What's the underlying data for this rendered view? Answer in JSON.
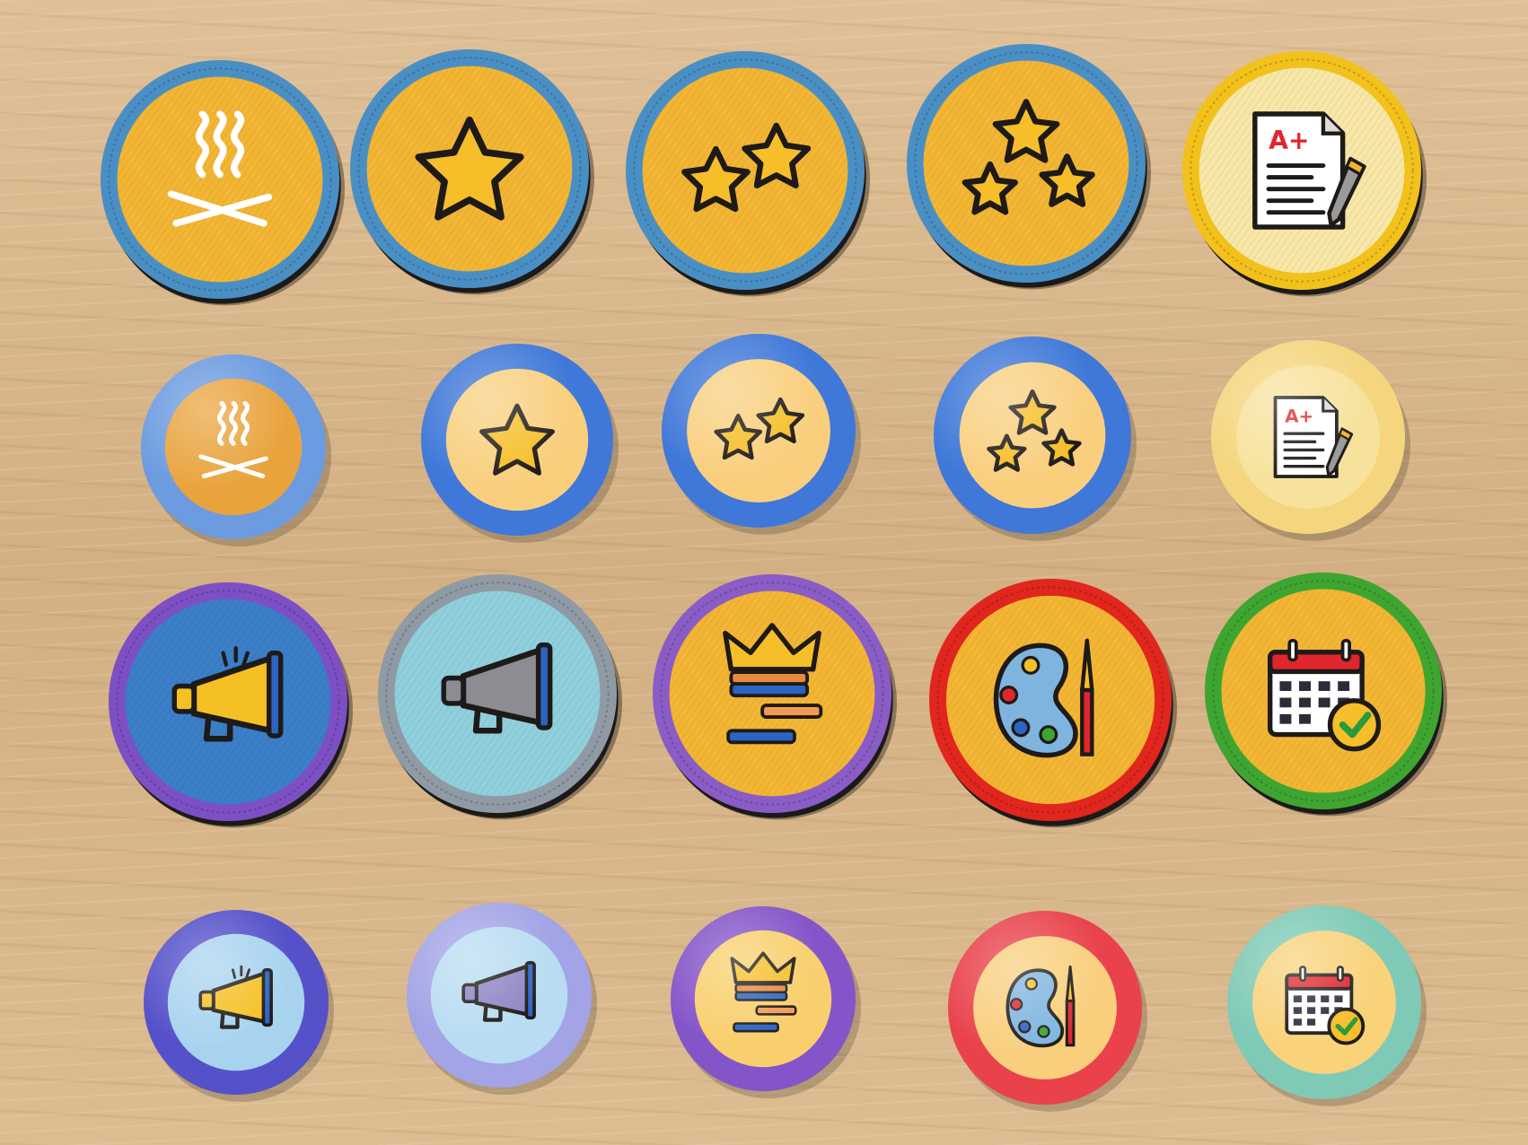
{
  "scene": {
    "description_tag": "badge-collection",
    "colors": {
      "wood": "#d9b88c",
      "patch_yellow": "#f4b82f",
      "button_light": "#f9cf7e"
    }
  },
  "rows": [
    {
      "kind": "embroidered-patch",
      "badges": [
        {
          "icon": "campfire-steam-icon",
          "rim": "#4a8fc4",
          "fill": "#f3b634"
        },
        {
          "icon": "one-star-icon",
          "rim": "#4a8fc4",
          "fill": "#f3b634"
        },
        {
          "icon": "two-stars-icon",
          "rim": "#4a8fc4",
          "fill": "#f3b634"
        },
        {
          "icon": "three-stars-icon",
          "rim": "#4a8fc4",
          "fill": "#f3b634"
        },
        {
          "icon": "graded-paper-icon",
          "rim": "#f2c11c",
          "fill": "#f8e7a6",
          "text": "A+"
        }
      ]
    },
    {
      "kind": "pin-button",
      "badges": [
        {
          "icon": "campfire-steam-icon",
          "rim": "#6c9be0",
          "fill": "#e9a33d"
        },
        {
          "icon": "one-star-icon",
          "rim": "#3f78d8",
          "fill": "#f9cf7e"
        },
        {
          "icon": "two-stars-icon",
          "rim": "#3f78d8",
          "fill": "#f9cf7e"
        },
        {
          "icon": "three-stars-icon",
          "rim": "#3f78d8",
          "fill": "#f9cf7e"
        },
        {
          "icon": "graded-paper-icon",
          "rim": "#f5d67f",
          "fill": "#f7e29c",
          "text": "A+"
        }
      ]
    },
    {
      "kind": "embroidered-patch",
      "badges": [
        {
          "icon": "megaphone-yellow-icon",
          "rim": "#7d4fc4",
          "fill": "#3a7fc7"
        },
        {
          "icon": "megaphone-gray-icon",
          "rim": "#8f9aa4",
          "fill": "#8fd0dc"
        },
        {
          "icon": "crown-chat-icon",
          "rim": "#8a5cc6",
          "fill": "#f3b634"
        },
        {
          "icon": "paint-palette-icon",
          "rim": "#e0261d",
          "fill": "#f3b634"
        },
        {
          "icon": "calendar-check-icon",
          "rim": "#3fa531",
          "fill": "#f3b634"
        }
      ]
    },
    {
      "kind": "pin-button",
      "badges": [
        {
          "icon": "megaphone-yellow-icon",
          "rim": "#5551c9",
          "fill": "#a8d3ef"
        },
        {
          "icon": "megaphone-purple-icon",
          "rim": "#a3a4e6",
          "fill": "#b9dcf2"
        },
        {
          "icon": "crown-chat-icon",
          "rim": "#8455c8",
          "fill": "#f9cf6d"
        },
        {
          "icon": "paint-palette-icon",
          "rim": "#e9424b",
          "fill": "#f9cf7e"
        },
        {
          "icon": "calendar-check-icon",
          "rim": "#7fcab6",
          "fill": "#f9d27a"
        }
      ]
    }
  ]
}
